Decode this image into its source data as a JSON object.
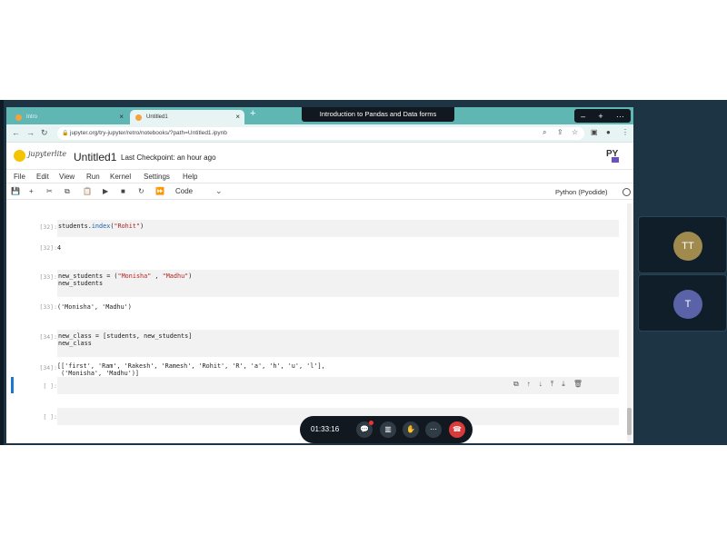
{
  "meeting": {
    "title": "Introduction to Pandas and Data forms",
    "timer": "01:33:16",
    "participants": [
      {
        "initials": "TT",
        "color": "#a08a4e"
      },
      {
        "initials": "T",
        "color": "#5b63a8"
      }
    ],
    "controls": [
      {
        "name": "chat",
        "icon": "chat-icon"
      },
      {
        "name": "stats",
        "icon": "bar-chart-icon"
      },
      {
        "name": "react",
        "icon": "hand-icon"
      },
      {
        "name": "more",
        "icon": "more-icon"
      },
      {
        "name": "end",
        "icon": "end-call-icon"
      }
    ],
    "window_controls": [
      "–",
      "+",
      "···"
    ]
  },
  "browser": {
    "tabs": [
      {
        "title": "Intro",
        "active": false
      },
      {
        "title": "Untitled1",
        "active": true
      }
    ],
    "new_tab": "+",
    "url": "jupyter.org/try-jupyter/retro/notebooks/?path=Untitled1.ipynb"
  },
  "jupyter": {
    "logo_text": "jupyterlite",
    "notebook_name": "Untitled1",
    "checkpoint": "Last Checkpoint: an hour ago",
    "py_badge": "PY",
    "menu": [
      "File",
      "Edit",
      "View",
      "Run",
      "Kernel",
      "Settings",
      "Help"
    ],
    "cell_type": "Code",
    "kernel": "Python (Pyodide)",
    "cells": {
      "c32_prompt": "[32]:",
      "c32_code_a": "students.",
      "c32_code_fn": "index",
      "c32_code_b": "(",
      "c32_code_str": "\"Rohit\"",
      "c32_code_c": ")",
      "o32_prompt": "[32]:",
      "o32_out": "4",
      "c33_prompt": "[33]:",
      "c33_line1_a": "new_students = (",
      "c33_line1_s1": "\"Monisha\"",
      "c33_line1_b": " , ",
      "c33_line1_s2": "\"Madhu\"",
      "c33_line1_c": ")",
      "c33_line2": "new_students",
      "o33_prompt": "[33]:",
      "o33_out": "('Monisha', 'Madhu')",
      "c34_prompt": "[34]:",
      "c34_line1": "new_class = [students, new_students]",
      "c34_line2": "new_class",
      "o34_prompt": "[34]:",
      "o34_line1": "[['first', 'Ram', 'Rakesh', 'Ramesh', 'Rohit', 'R', 'a', 'h', 'u', 'l'],",
      "o34_line2": " ('Monisha', 'Madhu')]",
      "empty1_prompt": "[ ]:",
      "empty2_prompt": "[ ]:"
    }
  }
}
